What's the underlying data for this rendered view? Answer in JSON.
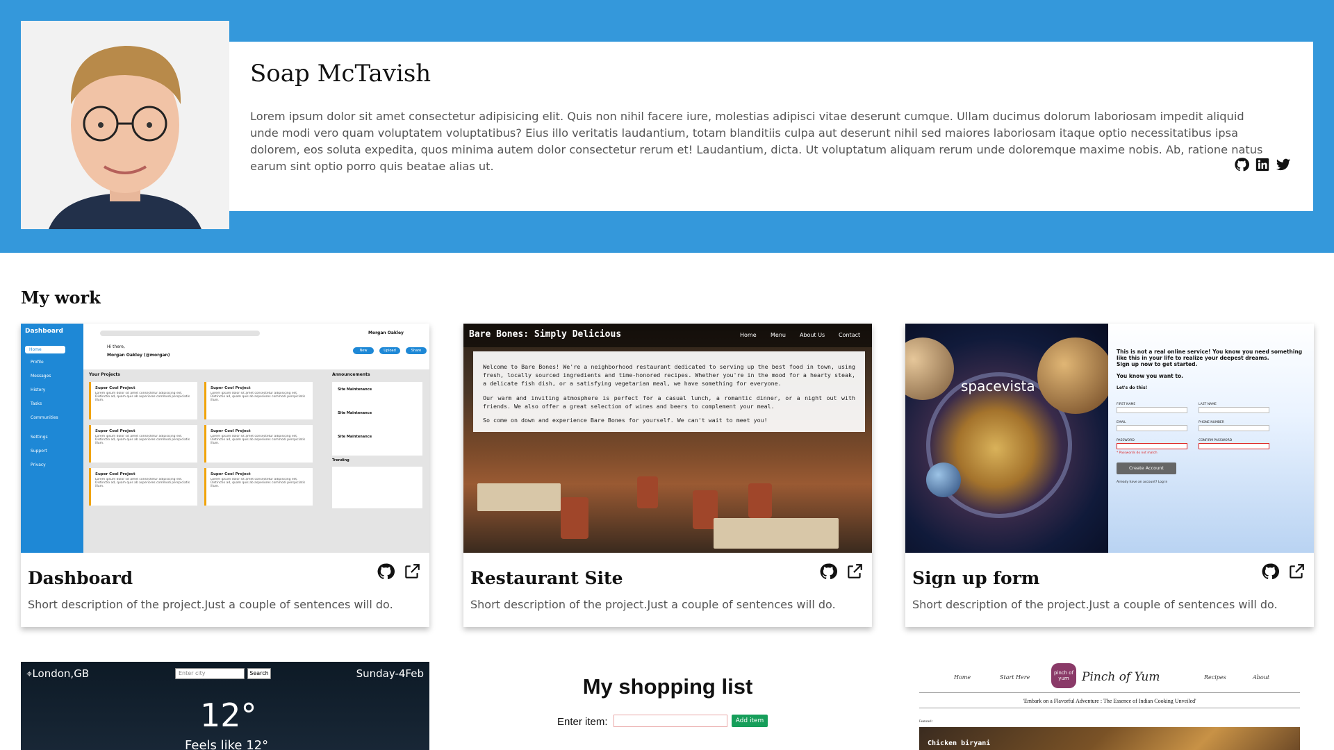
{
  "profile": {
    "name": "Soap McTavish",
    "bio": "Lorem ipsum dolor sit amet consectetur adipisicing elit. Quis non nihil facere iure, molestias adipisci vitae deserunt cumque. Ullam ducimus dolorum laboriosam impedit aliquid unde modi vero quam voluptatem voluptatibus? Eius illo veritatis laudantium, totam blanditiis culpa aut deserunt nihil sed maiores laboriosam itaque optio necessitatibus ipsa dolorem, eos soluta expedita, quos minima autem dolor consectetur rerum et! Laudantium, dicta. Ut voluptatum aliquam rerum unde doloremque maxime nobis. Ab, ratione natus earum sint optio porro quis beatae alias ut.",
    "socials": [
      "github-icon",
      "linkedin-icon",
      "twitter-icon"
    ]
  },
  "work": {
    "title": "My work",
    "projects": [
      {
        "title": "Dashboard",
        "description": "Short description of the project.Just a couple of sentences will do."
      },
      {
        "title": "Restaurant Site",
        "description": "Short description of the project.Just a couple of sentences will do."
      },
      {
        "title": "Sign up form",
        "description": "Short description of the project.Just a couple of sentences will do."
      }
    ]
  },
  "thumbs": {
    "dashboard": {
      "brand": "Dashboard",
      "nav": [
        "Home",
        "Profile",
        "Messages",
        "History",
        "Tasks",
        "Communities",
        "Settings",
        "Support",
        "Privacy"
      ],
      "user": "Morgan Oakley",
      "greeting": "Hi there,",
      "handle": "Morgan Oakley (@morgan)",
      "buttons": [
        "New",
        "Upload",
        "Share"
      ],
      "your_projects": "Your Projects",
      "project_title": "Super Cool Project",
      "project_text": "Lorem ipsum dolor sit amet consectetur adipisicing elit. Distinctio ad, quam quis ab asperiores commodi perspiciatis illum.",
      "announcements": "Announcements",
      "ann_items": [
        "Site Maintenance",
        "Site Maintenance",
        "Site Maintenance"
      ],
      "trending": "Trending"
    },
    "restaurant": {
      "brand": "Bare Bones: Simply Delicious",
      "links": [
        "Home",
        "Menu",
        "About Us",
        "Contact"
      ],
      "p1": "Welcome to Bare Bones! We're a neighborhood restaurant dedicated to serving up the best food in town, using fresh, locally sourced ingredients and time-honored recipes. Whether you're in the mood for a hearty steak, a delicate fish dish, or a satisfying vegetarian meal, we have something for everyone.",
      "p2": "Our warm and inviting atmosphere is perfect for a casual lunch, a romantic dinner, or a night out with friends. We also offer a great selection of wines and beers to complement your meal.",
      "p3": "So come on down and experience Bare Bones for yourself. We can't wait to meet you!"
    },
    "signup": {
      "brand": "spacevista",
      "intro1": "This is not a real online service! You know you need something like this in your life to realize your deepest dreams.",
      "intro2": "Sign up now to get started.",
      "intro3": "You know you want to.",
      "lets": "Let's do this!",
      "labels": [
        "FIRST NAME",
        "LAST NAME",
        "EMAIL",
        "PHONE NUMBER",
        "PASSWORD",
        "CONFIRM PASSWORD"
      ],
      "error": "* Passwords do not match",
      "button": "Create Account",
      "login": "Already have an account?  Log in"
    },
    "weather": {
      "location": "London,GB",
      "placeholder": "Enter city",
      "search": "Search",
      "date": "Sunday-4Feb",
      "temp": "12°",
      "feels": "Feels like 12°"
    },
    "shopping": {
      "title": "My shopping list",
      "label": "Enter item:",
      "button": "Add item"
    },
    "yum": {
      "links": [
        "Home",
        "Start Here",
        "Recipes",
        "About"
      ],
      "logo": "pinch of yum",
      "title": "Pinch of Yum",
      "tagline": "'Embark on a Flavorful Adventure : The Essence of Indian Cooking Unveiled'",
      "featured": "Featured :",
      "dish": "Chicken biryani"
    }
  }
}
